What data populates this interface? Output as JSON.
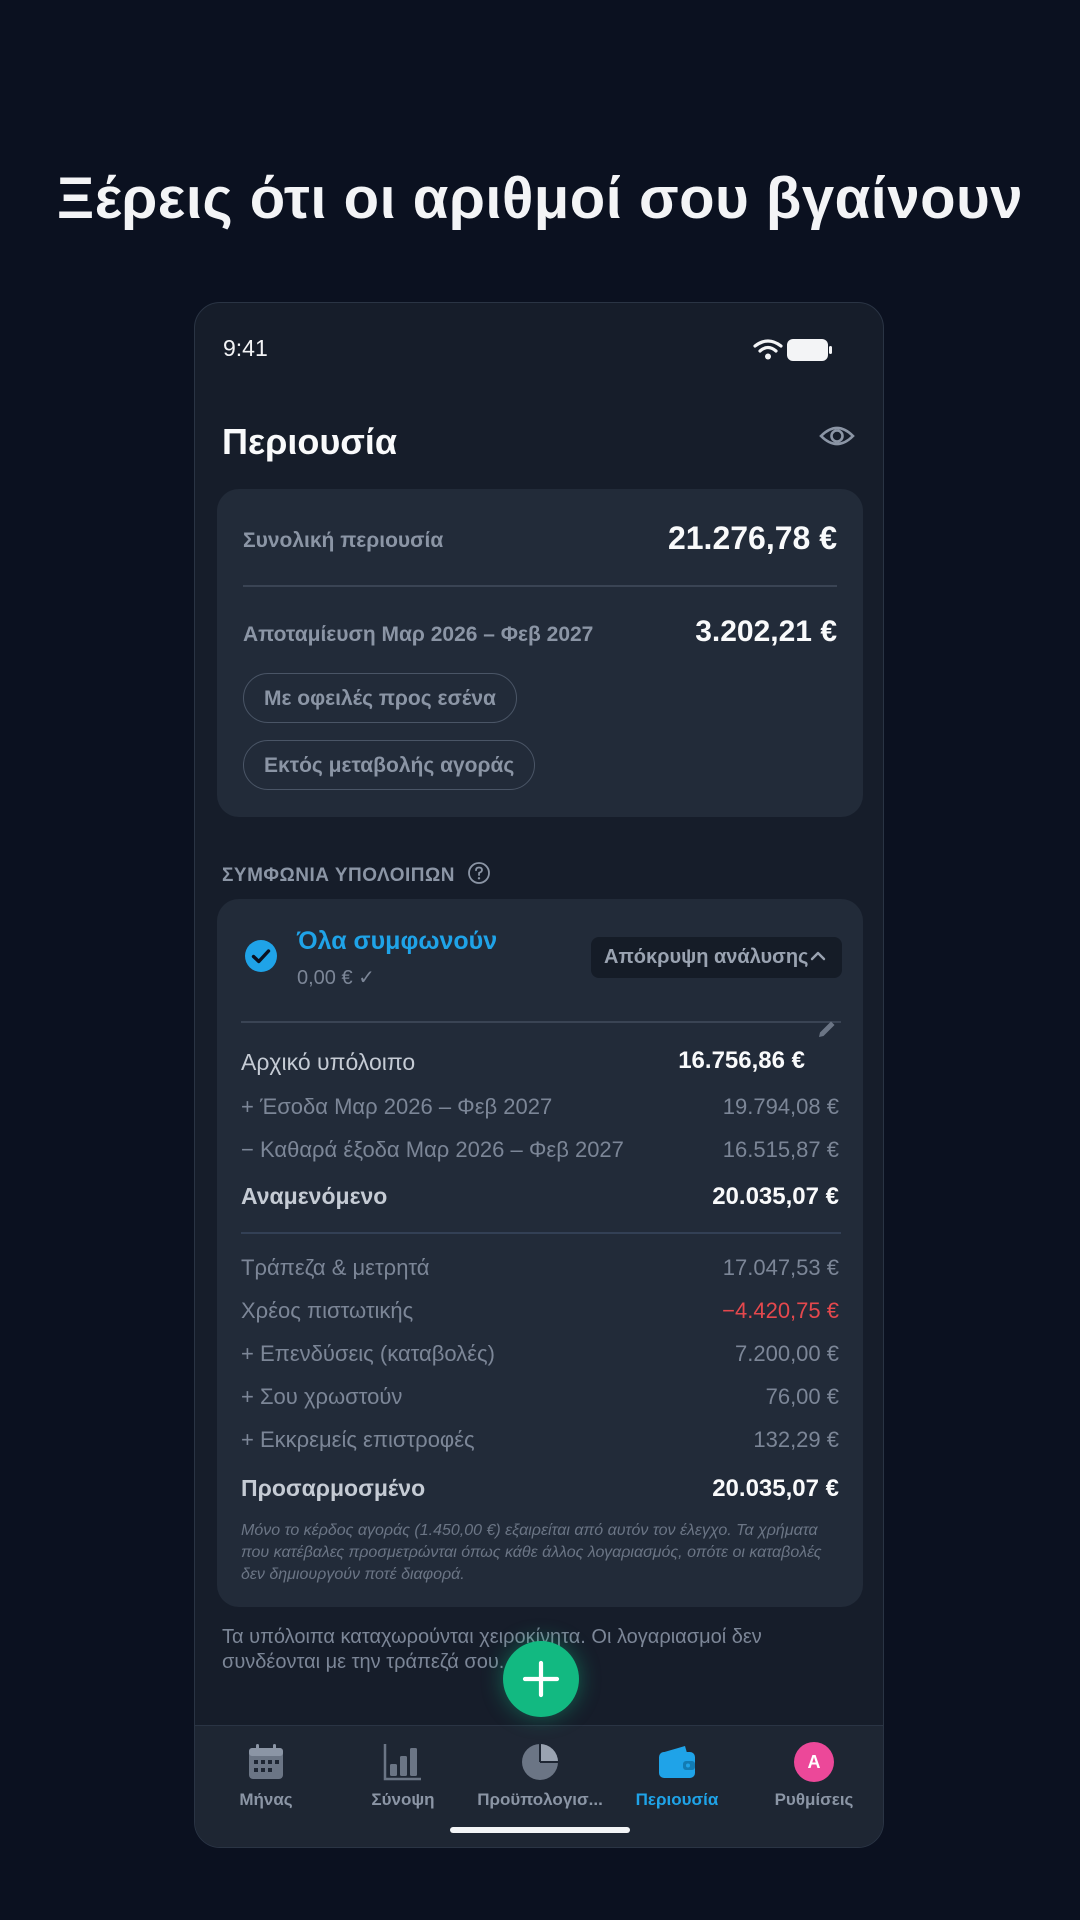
{
  "headline": "Ξέρεις ότι οι αριθμοί σου βγαίνουν",
  "status": {
    "time": "9:41"
  },
  "page": {
    "title": "Περιουσία"
  },
  "summary": {
    "total_label": "Συνολική περιουσία",
    "total_value": "21.276,78 €",
    "savings_label": "Αποταμίευση Μαρ 2026 – Φεβ 2027",
    "savings_value": "3.202,21 €",
    "pill_debts": "Με οφειλές προς εσένα",
    "pill_market": "Εκτός μεταβολής αγοράς"
  },
  "reconciliation": {
    "section_label": "ΣΥΜΦΩΝΙΑ ΥΠΟΛΟΙΠΩΝ",
    "status_title": "Όλα συμφωνούν",
    "status_diff": "0,00 € ✓",
    "hide_button": "Απόκρυψη ανάλυσης",
    "rows": [
      {
        "label": "Αρχικό υπόλοιπο",
        "value": "16.756,86 €"
      },
      {
        "label": "+ Έσοδα Μαρ 2026 – Φεβ 2027",
        "value": "19.794,08 €"
      },
      {
        "label": "− Καθαρά έξοδα Μαρ 2026 – Φεβ 2027",
        "value": "16.515,87 €"
      },
      {
        "label": "Αναμενόμενο",
        "value": "20.035,07 €"
      },
      {
        "label": "Τράπεζα & μετρητά",
        "value": "17.047,53 €"
      },
      {
        "label": "Χρέος πιστωτικής",
        "value": "−4.420,75 €"
      },
      {
        "label": "+ Επενδύσεις (καταβολές)",
        "value": "7.200,00 €"
      },
      {
        "label": "+ Σου χρωστούν",
        "value": "76,00 €"
      },
      {
        "label": "+ Εκκρεμείς επιστροφές",
        "value": "132,29 €"
      },
      {
        "label": "Προσαρμοσμένο",
        "value": "20.035,07 €"
      }
    ],
    "note": "Μόνο το κέρδος αγοράς (1.450,00 €) εξαιρείται από αυτόν τον έλεγχο. Τα χρήματα που κατέβαλες προσμετρώνται όπως κάθε άλλος λογαριασμός, οπότε οι καταβολές δεν δημιουργούν ποτέ διαφορά."
  },
  "footer_text": "Τα υπόλοιπα καταχωρούνται χειροκίνητα. Οι λογαριασμοί δεν συνδέονται με την τράπεζά σου.",
  "tabs": [
    {
      "label": "Μήνας",
      "icon": "calendar-icon"
    },
    {
      "label": "Σύνοψη",
      "icon": "bar-chart-icon"
    },
    {
      "label": "Προϋπολογισ...",
      "icon": "pie-chart-icon"
    },
    {
      "label": "Περιουσία",
      "icon": "wallet-icon",
      "active": true
    },
    {
      "label": "Ρυθμίσεις",
      "icon": "avatar",
      "avatar_letter": "A"
    }
  ],
  "colors": {
    "accent": "#1fa3e8",
    "fab": "#12b981",
    "negative": "#e5484d",
    "avatar": "#ec4899"
  }
}
